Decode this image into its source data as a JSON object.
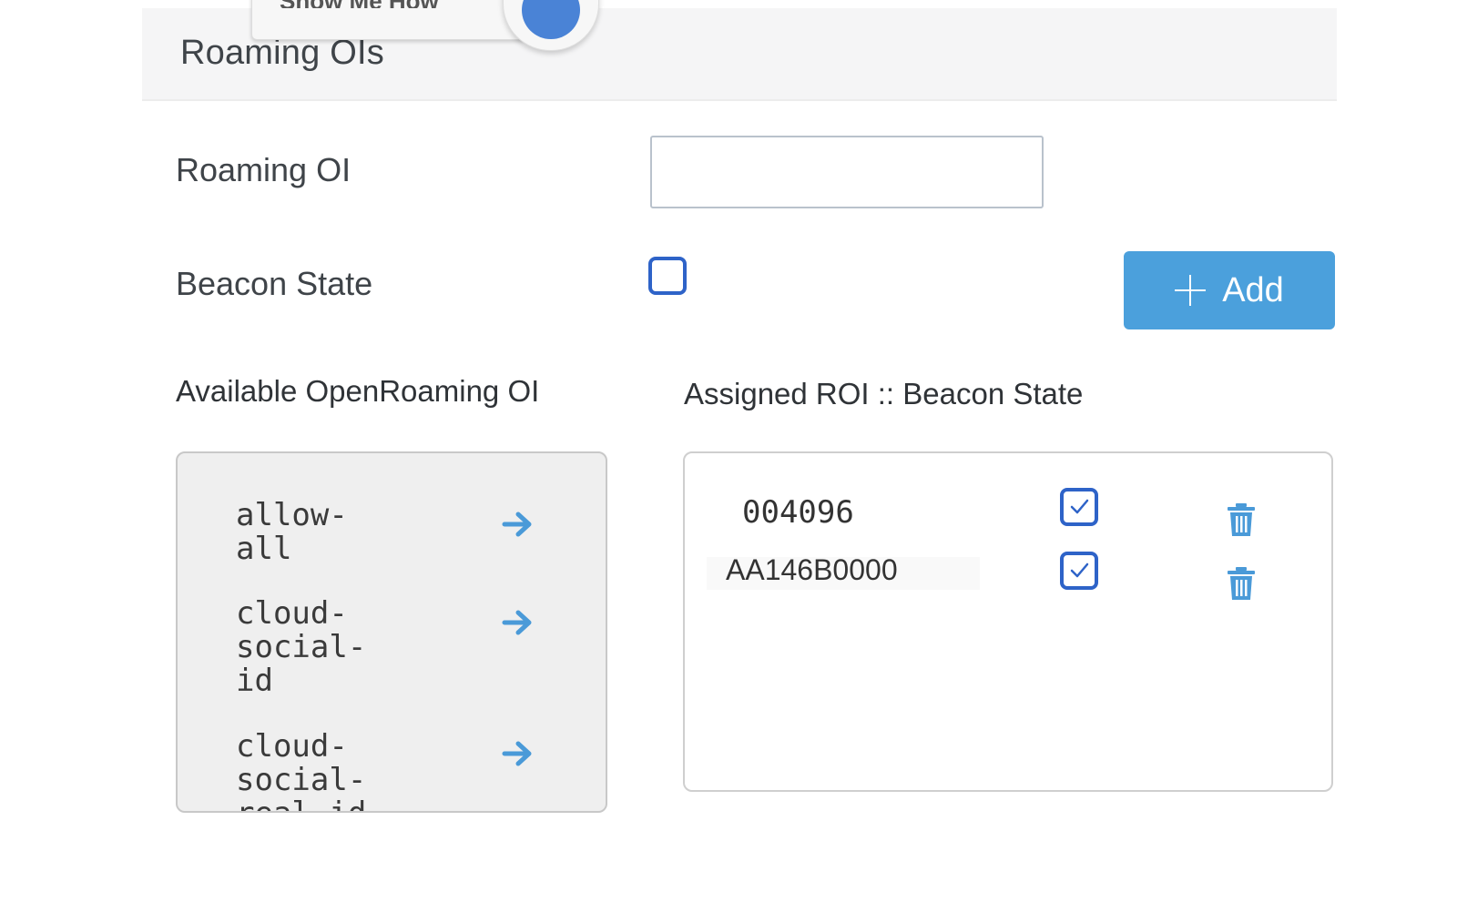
{
  "header": {
    "title": "Roaming OIs",
    "tooltip_label": "Show Me How"
  },
  "form": {
    "roaming_oi_label": "Roaming OI",
    "roaming_oi_value": "",
    "beacon_state_label": "Beacon State",
    "beacon_state_checked": false,
    "add_button_label": "Add"
  },
  "available": {
    "heading": "Available OpenRoaming OI",
    "items": [
      {
        "label": "allow-\nall"
      },
      {
        "label": "cloud-\nsocial-\nid"
      },
      {
        "label": "cloud-\nsocial-\nreal-id"
      }
    ]
  },
  "assigned": {
    "heading": "Assigned ROI :: Beacon State",
    "rows": [
      {
        "roi": "004096",
        "beacon": true
      },
      {
        "roi": "AA146B0000",
        "beacon": true
      }
    ]
  },
  "colors": {
    "accent": "#4ba0dc",
    "checkbox_border": "#2e63c8",
    "arrow": "#4a9ad8"
  },
  "icons": {
    "add": "plus-icon",
    "move": "arrow-right-icon",
    "delete": "trash-icon",
    "checked": "check-icon"
  }
}
